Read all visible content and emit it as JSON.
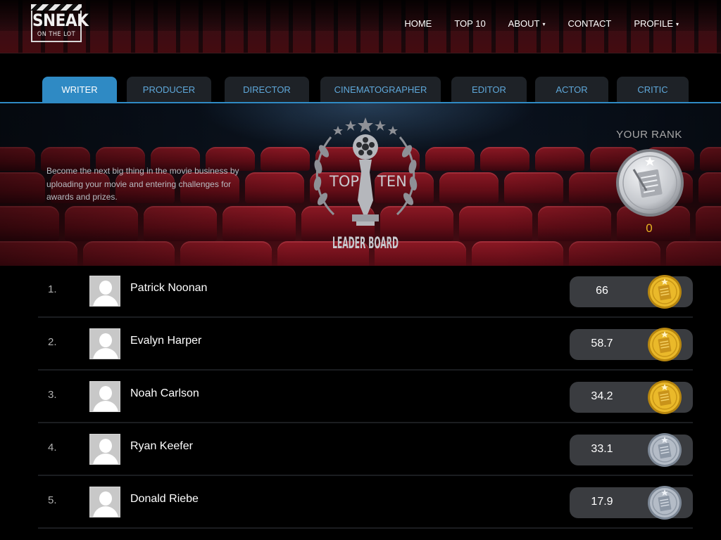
{
  "brand": {
    "logo_main": "SNEAK",
    "logo_sub": "ON THE LOT"
  },
  "nav": {
    "items": [
      {
        "label": "HOME",
        "dropdown": false
      },
      {
        "label": "TOP 10",
        "dropdown": false
      },
      {
        "label": "ABOUT",
        "dropdown": true
      },
      {
        "label": "CONTACT",
        "dropdown": false
      },
      {
        "label": "PROFILE",
        "dropdown": true
      }
    ],
    "caret": "▾"
  },
  "tabs": {
    "items": [
      "WRITER",
      "PRODUCER",
      "DIRECTOR",
      "CINEMATOGRAPHER",
      "EDITOR",
      "ACTOR",
      "CRITIC"
    ],
    "active": "WRITER"
  },
  "hero": {
    "text": "Become the next big thing in the movie business by uploading your movie and entering challenges for awards and prizes.",
    "emblem": {
      "left_word": "TOP",
      "right_word": "TEN",
      "bottom_words": "LEADER BOARD"
    }
  },
  "your_rank": {
    "title": "YOUR RANK",
    "value": "0",
    "medal": "silver"
  },
  "leaderboard": [
    {
      "rank": "1.",
      "name": "Patrick Noonan",
      "score": "66",
      "medal": "gold"
    },
    {
      "rank": "2.",
      "name": "Evalyn Harper",
      "score": "58.7",
      "medal": "gold"
    },
    {
      "rank": "3.",
      "name": "Noah Carlson",
      "score": "34.2",
      "medal": "gold"
    },
    {
      "rank": "4.",
      "name": "Ryan Keefer",
      "score": "33.1",
      "medal": "silver"
    },
    {
      "rank": "5.",
      "name": "Donald Riebe",
      "score": "17.9",
      "medal": "silver"
    }
  ],
  "colors": {
    "accent_blue": "#2f8ac4",
    "tab_text": "#5fa8da",
    "gold": "#e7b422",
    "silver": "#b8bcc2"
  }
}
